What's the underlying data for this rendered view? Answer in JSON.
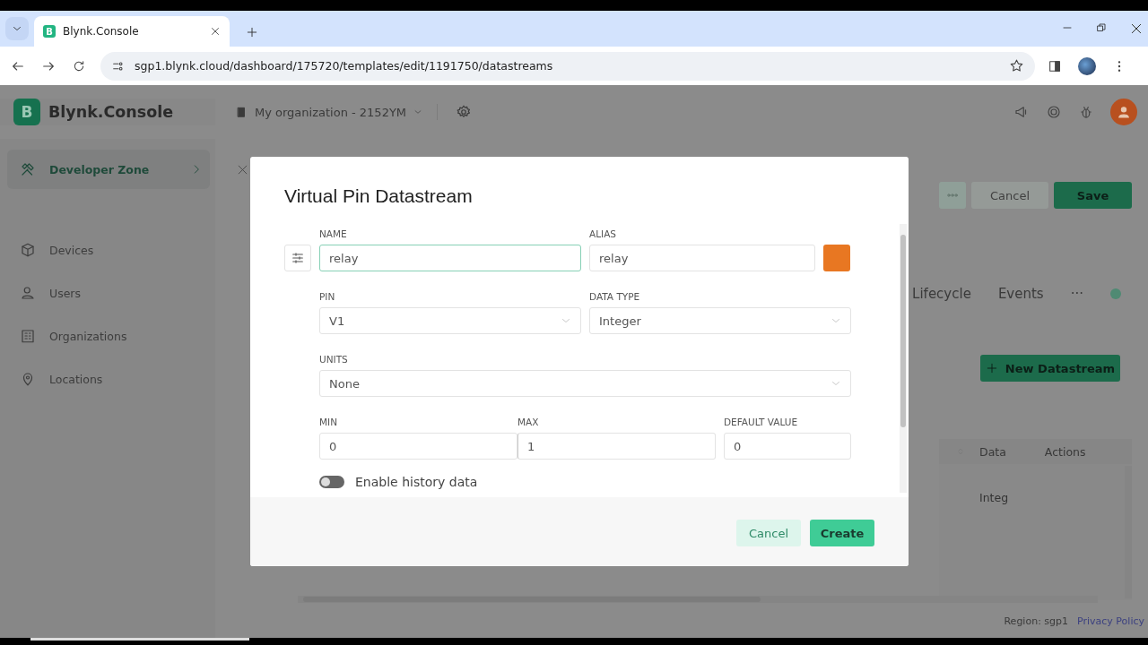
{
  "browser": {
    "favicon_letter": "B",
    "tab_title": "Blynk.Console",
    "url": "sgp1.blynk.cloud/dashboard/175720/templates/edit/1191750/datastreams"
  },
  "header": {
    "logo_letter": "B",
    "brand": "Blynk.Console",
    "organization": "My organization - 2152YM"
  },
  "sidebar": {
    "items": [
      {
        "label": "Developer Zone",
        "selected": true
      },
      {
        "label": "Devices",
        "selected": false
      },
      {
        "label": "Users",
        "selected": false
      },
      {
        "label": "Organizations",
        "selected": false
      },
      {
        "label": "Locations",
        "selected": false
      }
    ]
  },
  "page": {
    "buttons": [
      "Cancel",
      "Save"
    ],
    "tabs": [
      {
        "label": "Lifecycle"
      },
      {
        "label": "Events"
      },
      {
        "label": "···"
      }
    ],
    "new_button": "New Datastream",
    "table": {
      "columns": [
        "Data",
        "Actions"
      ],
      "rows": [
        [
          "Integ"
        ]
      ]
    },
    "footer": {
      "region": "Region: sgp1",
      "link": "Privacy Policy"
    }
  },
  "dialog": {
    "title": "Virtual Pin Datastream",
    "name": {
      "label": "NAME",
      "value": "relay",
      "focused": true
    },
    "alias": {
      "label": "ALIAS",
      "value": "relay"
    },
    "color": "#e87722",
    "pin": {
      "label": "PIN",
      "value": "V1"
    },
    "data_type": {
      "label": "DATA TYPE",
      "value": "Integer"
    },
    "units": {
      "label": "UNITS",
      "value": "None"
    },
    "range": [
      {
        "label": "MIN",
        "value": "0"
      },
      {
        "label": "MAX",
        "value": "1"
      },
      {
        "label": "DEFAULT VALUE",
        "value": "0"
      }
    ],
    "history": {
      "label": "Enable history data",
      "on": false
    },
    "buttons": [
      "Cancel",
      "Create"
    ]
  }
}
